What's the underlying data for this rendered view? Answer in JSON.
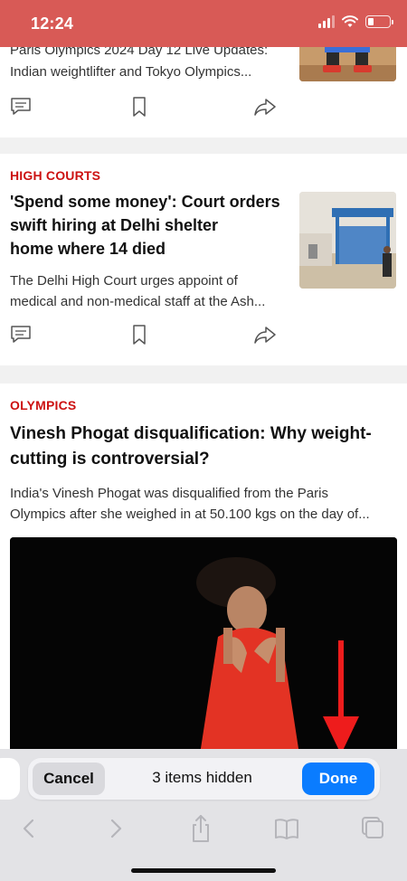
{
  "status_bar": {
    "time": "12:24"
  },
  "feed": {
    "articles": [
      {
        "title": "Paris Olympics 2024 Day 12 Live Updates:",
        "summary_line_2": "Indian weightlifter and Tokyo Olympics..."
      },
      {
        "category": "HIGH COURTS",
        "title_lines": [
          "'Spend some money': Court orders",
          "swift hiring at Delhi shelter",
          "home where 14 died"
        ],
        "summary_lines": [
          "The Delhi High Court urges appoint of",
          "medical and non-medical staff at the Ash..."
        ]
      },
      {
        "category": "OLYMPICS",
        "title_lines": [
          "Vinesh Phogat disqualification: Why weight-",
          "cutting is controversial?"
        ],
        "summary_lines": [
          "India's Vinesh Phogat was disqualified from the Paris",
          "Olympics after she weighed in at 50.100 kgs on the day of..."
        ]
      }
    ],
    "action_icons": [
      "comment-icon",
      "bookmark-icon",
      "share-icon"
    ]
  },
  "hide_bar": {
    "cancel_label": "Cancel",
    "status_text": "3 items hidden",
    "done_label": "Done"
  },
  "toolbar": {
    "icons": [
      "back-icon",
      "forward-icon",
      "share-icon",
      "bookmarks-icon",
      "tabs-icon"
    ]
  },
  "colors": {
    "status_bar_bg": "#d85a56",
    "category_red": "#cc1111",
    "done_blue": "#0a7cff",
    "annotation_arrow": "#ee1c1c"
  }
}
